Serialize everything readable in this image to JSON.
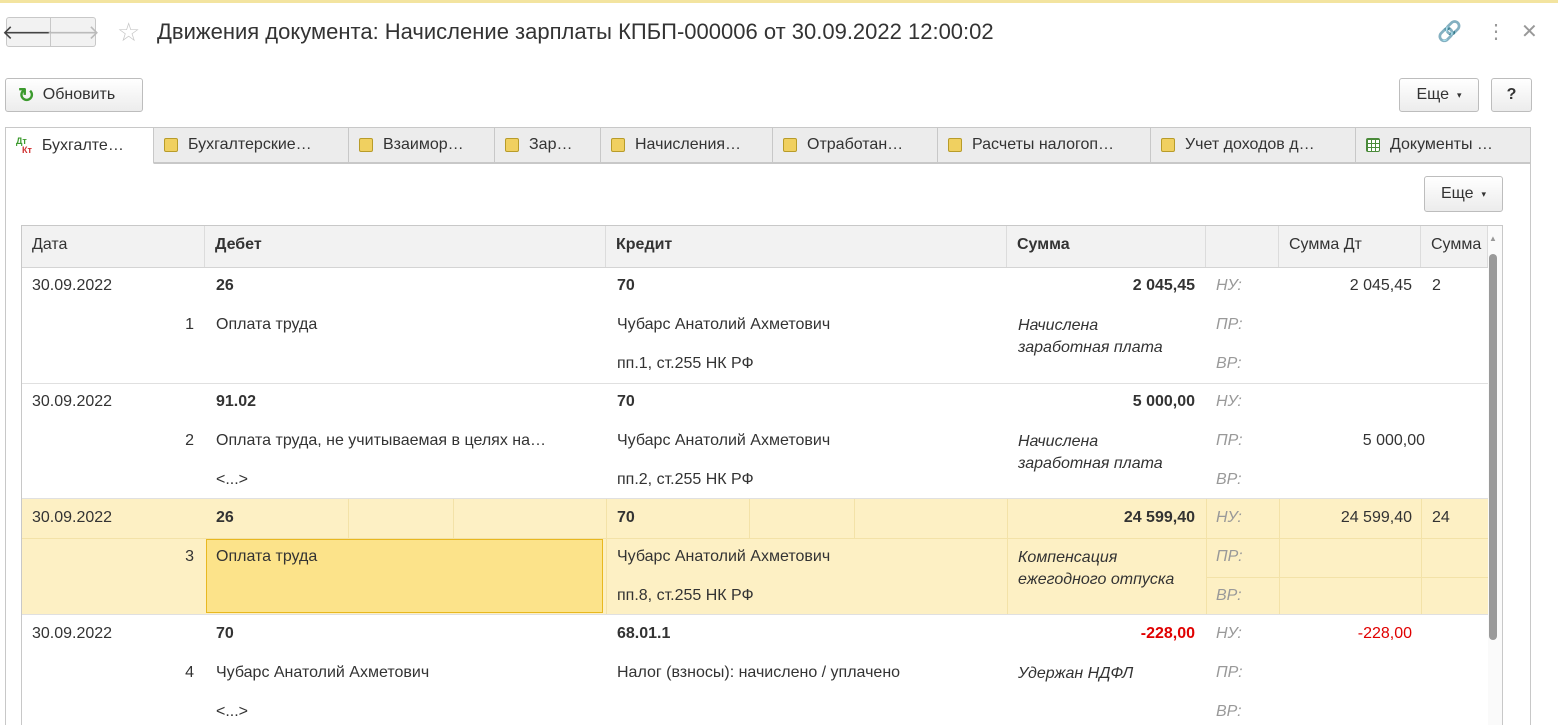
{
  "window": {
    "title": "Движения документа: Начисление зарплаты КПБП-000006 от 30.09.2022 12:00:02",
    "back_glyph": "🡐",
    "forward_glyph": "🡒",
    "star_glyph": "☆",
    "link_glyph": "🔗",
    "menu_glyph": "⋮",
    "close_glyph": "✕"
  },
  "toolbar": {
    "refresh_label": "Обновить",
    "refresh_glyph": "↻",
    "more_label": "Еще",
    "help_label": "?",
    "caret": "▾"
  },
  "tabs": [
    {
      "label": "Бухгалте…",
      "icon": "dt-kt-icon",
      "dt": "Дт",
      "kt": "Кт"
    },
    {
      "label": "Бухгалтерские…",
      "icon": "register-icon"
    },
    {
      "label": "Взаимор…",
      "icon": "register-icon"
    },
    {
      "label": "Зар…",
      "icon": "register-icon"
    },
    {
      "label": "Начисления…",
      "icon": "register-icon"
    },
    {
      "label": "Отработан…",
      "icon": "register-icon"
    },
    {
      "label": "Расчеты налогоп…",
      "icon": "register-icon"
    },
    {
      "label": "Учет доходов д…",
      "icon": "register-icon"
    },
    {
      "label": "Документы …",
      "icon": "grid-icon"
    }
  ],
  "panel": {
    "more_label": "Еще"
  },
  "table": {
    "columns": [
      "Дата",
      "Дебет",
      "Кредит",
      "Сумма",
      "",
      "Сумма Дт",
      "Сумма"
    ],
    "rows": [
      {
        "date": "30.09.2022",
        "num": "1",
        "debit": "26",
        "debit_sub": "Оплата труда",
        "debit_sub2": "",
        "credit": "70",
        "credit_sub": "Чубарс Анатолий Ахметович",
        "credit_sub2": "пп.1, ст.255 НК РФ",
        "amount": "2 045,45",
        "comment": "Начислена заработная плата",
        "nu": "НУ:",
        "pr": "ПР:",
        "vr": "ВР:",
        "dt_nu": "2 045,45",
        "dt_pr": "",
        "edge": "2"
      },
      {
        "date": "30.09.2022",
        "num": "2",
        "debit": "91.02",
        "debit_sub": "Оплата труда, не учитываемая в целях на…",
        "debit_sub2": "<...>",
        "credit": "70",
        "credit_sub": "Чубарс Анатолий Ахметович",
        "credit_sub2": "пп.2, ст.255 НК РФ",
        "amount": "5 000,00",
        "comment": "Начислена заработная плата",
        "nu": "НУ:",
        "pr": "ПР:",
        "vr": "ВР:",
        "dt_nu": "",
        "dt_pr": "5 000,00",
        "edge": ""
      },
      {
        "date": "30.09.2022",
        "num": "3",
        "debit": "26",
        "debit_sub": "Оплата труда",
        "debit_sub2": "",
        "credit": "70",
        "credit_sub": "Чубарс Анатолий Ахметович",
        "credit_sub2": "пп.8, ст.255 НК РФ",
        "amount": "24 599,40",
        "comment": "Компенсация ежегодного отпуска",
        "nu": "НУ:",
        "pr": "ПР:",
        "vr": "ВР:",
        "dt_nu": "24 599,40",
        "dt_pr": "",
        "edge": "24"
      },
      {
        "date": "30.09.2022",
        "num": "4",
        "debit": "70",
        "debit_sub": "Чубарс Анатолий Ахметович",
        "debit_sub2": "<...>",
        "credit": "68.01.1",
        "credit_sub": "Налог (взносы): начислено / уплачено",
        "credit_sub2": "",
        "amount": "-228,00",
        "comment": "Удержан НДФЛ",
        "nu": "НУ:",
        "pr": "ПР:",
        "vr": "ВР:",
        "dt_nu": "-228,00",
        "dt_pr": "",
        "edge": ""
      }
    ]
  },
  "colors": {
    "selected_row": "#fdf0c4",
    "current_cell": "#fce38a",
    "negative": "#e00000",
    "refresh_icon": "#3c9a2e"
  }
}
